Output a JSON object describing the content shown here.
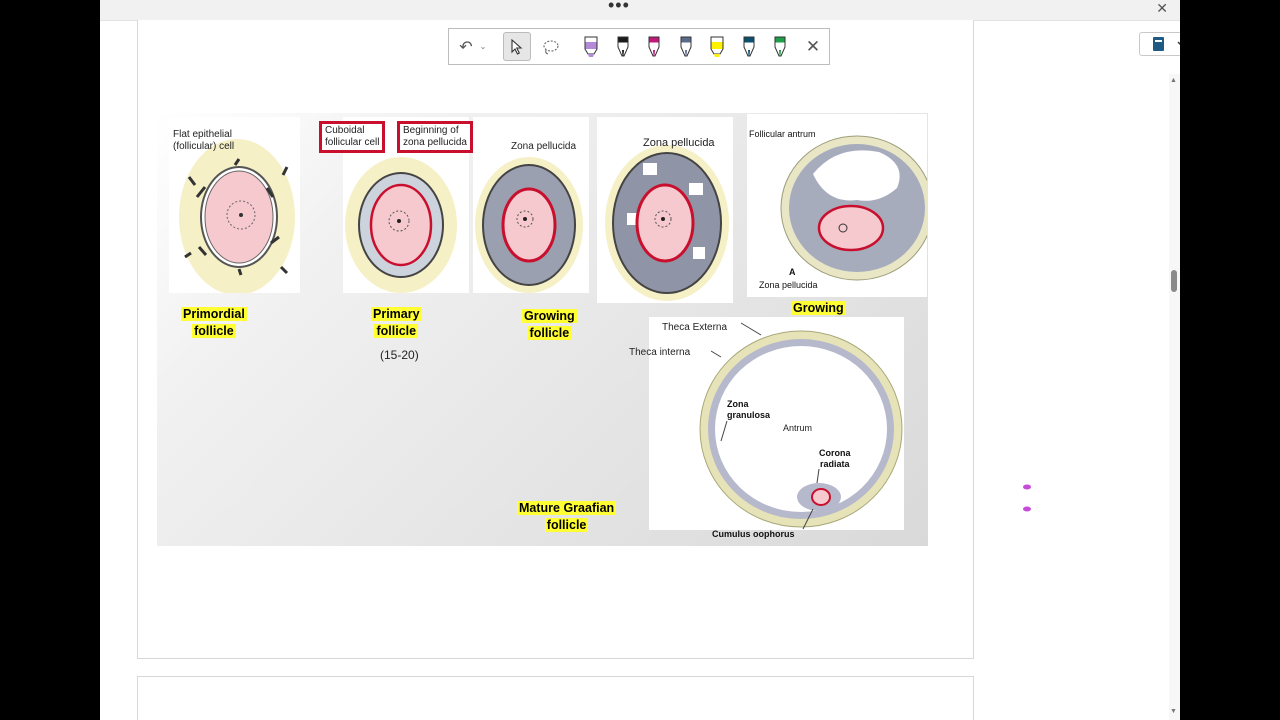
{
  "window": {
    "more_label": "•••",
    "close_label": "✕"
  },
  "toolbar": {
    "undo_label": "↶",
    "undo_menu_label": "⌄",
    "close_label": "✕",
    "pens": [
      {
        "name": "lavender-highlighter-icon",
        "color": "#b48ad8"
      },
      {
        "name": "black-pen-icon",
        "color": "#1a1a1a"
      },
      {
        "name": "magenta-pen-icon",
        "color": "#c2187a"
      },
      {
        "name": "galaxy-pen-icon",
        "color": "#5b6b8c"
      },
      {
        "name": "yellow-highlighter-icon",
        "color": "#fff200"
      },
      {
        "name": "teal-pen-icon",
        "color": "#0b4f6c"
      },
      {
        "name": "green-pen-icon",
        "color": "#1e9e4a"
      }
    ]
  },
  "figure": {
    "primordial": {
      "note": "Flat epithelial\n(follicular) cell",
      "title_line1": "Primordial",
      "title_line2": "follicle"
    },
    "primary": {
      "box1": "Cuboidal\nfollicular cell",
      "box2": "Beginning of\nzona pellucida",
      "title_line1": "Primary",
      "title_line2": "follicle",
      "count": "(15-20)"
    },
    "growing1": {
      "label": "Zona pellucida",
      "title_line1": "Growing",
      "title_line2": "follicle"
    },
    "growing2": {
      "label": "Zona pellucida"
    },
    "growing3": {
      "label_top": "Follicular antrum",
      "letter": "A",
      "label_bottom": "Zona pellucida",
      "title": "Growing"
    },
    "graafian": {
      "theca_externa": "Theca Externa",
      "theca_interna": "Theca interna",
      "zona_granulosa": "Zona\ngranulosa",
      "antrum": "Antrum",
      "corona_radiata": "Corona\nradiata",
      "cumulus": "Cumulus oophorus",
      "title_line1": "Mature Graafian",
      "title_line2": "follicle"
    }
  },
  "colors": {
    "accent_red": "#c8102e",
    "highlight_yellow": "#ffff33",
    "oocyte_pink": "#f6c9cf",
    "notebook_blue": "#1f5a85"
  }
}
